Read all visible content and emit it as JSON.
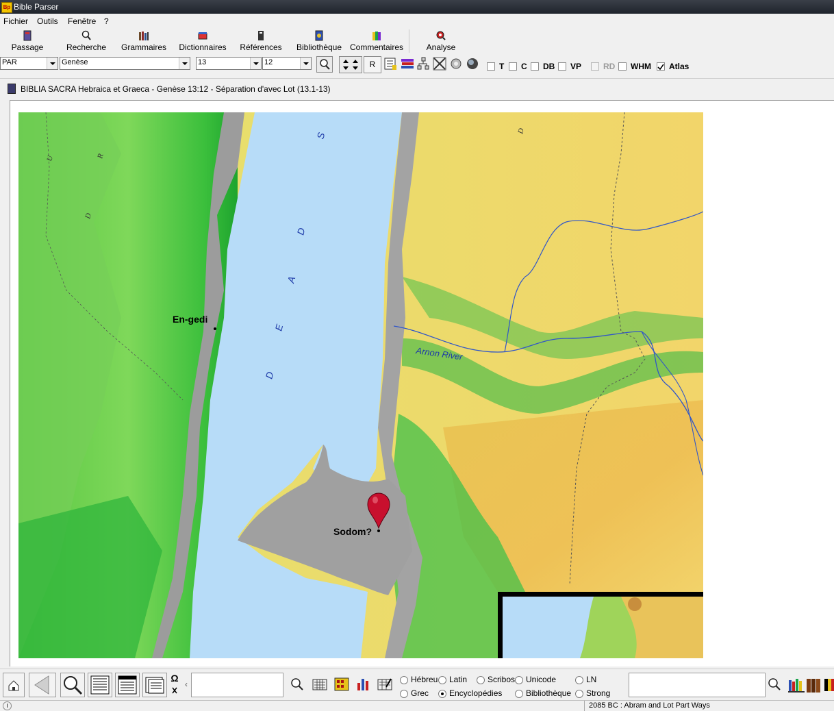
{
  "window": {
    "title": "Bible Parser",
    "icon_text": "Bp"
  },
  "menu": [
    {
      "label": "Fichier"
    },
    {
      "label": "Outils"
    },
    {
      "label": "Fenêtre"
    },
    {
      "label": "?"
    }
  ],
  "toolbar": {
    "passage": "Passage",
    "recherche": "Recherche",
    "grammaires": "Grammaires",
    "dictionnaires": "Dictionnaires",
    "references": "Références",
    "bibliotheque": "Bibliothèque",
    "commentaires": "Commentaires",
    "analyse": "Analyse"
  },
  "selectors": {
    "version": "PAR",
    "book": "Genèse",
    "chapter": "13",
    "verse": "12",
    "r_button": "R"
  },
  "checkboxes": [
    {
      "label": "T",
      "checked": false,
      "disabled": false
    },
    {
      "label": "C",
      "checked": false,
      "disabled": false
    },
    {
      "label": "DB",
      "checked": false,
      "disabled": false
    },
    {
      "label": "VP",
      "checked": false,
      "disabled": false
    },
    {
      "label": "RD",
      "checked": false,
      "disabled": true
    },
    {
      "label": "WHM",
      "checked": false,
      "disabled": false
    },
    {
      "label": "Atlas",
      "checked": true,
      "disabled": false
    }
  ],
  "document": {
    "title": "BIBLIA SACRA Hebraica et Graeca - Genèse 13:12 - Séparation d'avec Lot (13.1-13)"
  },
  "map": {
    "sea_letters": [
      "S",
      "D",
      "A",
      "E",
      "D"
    ],
    "places": {
      "engedi": "En-gedi",
      "sodom": "Sodom?"
    },
    "river": "Arnon River",
    "region_letters": [
      "U",
      "R",
      "D",
      "D"
    ],
    "colors": {
      "sea": "#b7dcf8",
      "lowland_green": "#4fcf4a",
      "highland": "#f0d56a",
      "cliff": "#9c9c9c",
      "pin": "#c8102e"
    }
  },
  "bottom": {
    "omega": "Ω",
    "radios": [
      {
        "label": "Hébreu",
        "checked": false
      },
      {
        "label": "Latin",
        "checked": false
      },
      {
        "label": "Scribos",
        "checked": false
      },
      {
        "label": "Unicode",
        "checked": false
      },
      {
        "label": "LN",
        "checked": false
      },
      {
        "label": "Grec",
        "checked": false
      },
      {
        "label": "Encyclopédies",
        "checked": true
      },
      {
        "label": "Bibliothèque",
        "checked": false
      },
      {
        "label": "Strong",
        "checked": false
      }
    ]
  },
  "status": {
    "text": "2085 BC : Abram and Lot Part Ways",
    "left_icon": "i"
  }
}
